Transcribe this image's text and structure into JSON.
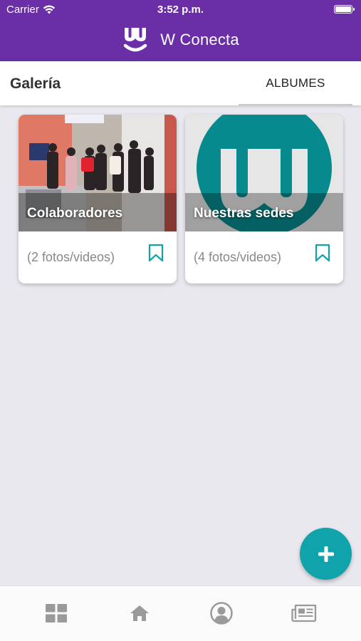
{
  "status_bar": {
    "carrier": "Carrier",
    "time": "3:52 p.m."
  },
  "header": {
    "app_title": "W Conecta",
    "logo_icon": "w-conecta-logo-icon"
  },
  "section": {
    "title": "Galería",
    "active_tab": "ALBUMES"
  },
  "albums": [
    {
      "title": "Colaboradores",
      "count": "(2 fotos/videos)",
      "cover": "group-photo"
    },
    {
      "title": "Nuestras sedes",
      "count": "(4 fotos/videos)",
      "cover": "w-logo-teal"
    }
  ],
  "fab": {
    "icon": "plus-icon"
  },
  "bottom_nav": [
    {
      "icon": "grid-icon"
    },
    {
      "icon": "home-icon"
    },
    {
      "icon": "user-icon"
    },
    {
      "icon": "newspaper-icon"
    }
  ],
  "colors": {
    "brand_purple": "#6a2ea7",
    "accent_teal": "#11a3ac",
    "background": "#e9e8ef",
    "nav_icon": "#9a9a9a"
  }
}
